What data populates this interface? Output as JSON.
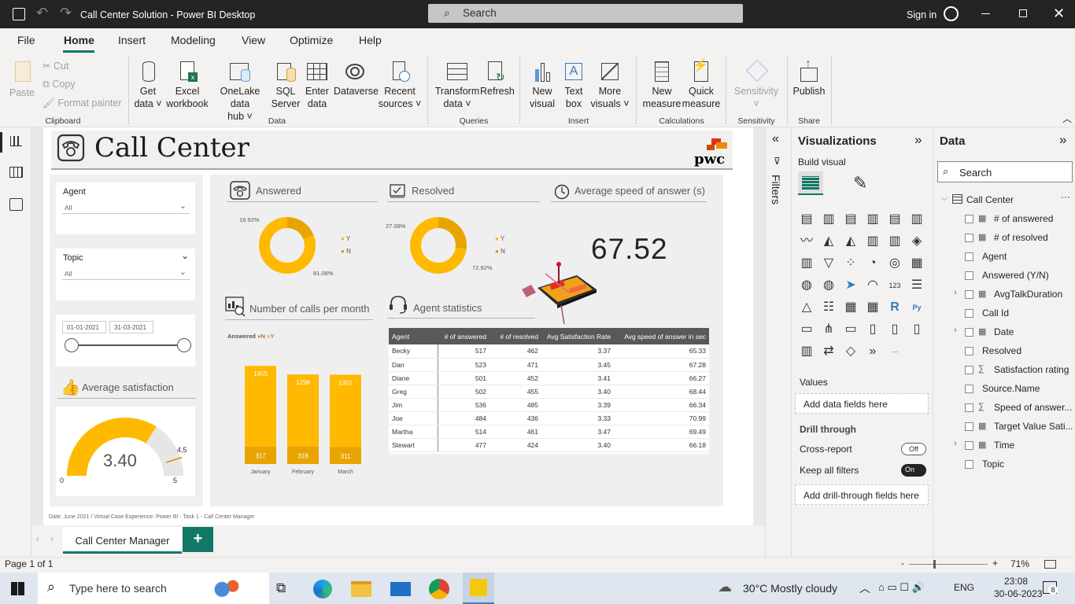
{
  "window": {
    "title": "Call Center Solution - Power BI Desktop",
    "search_placeholder": "Search",
    "sign_in": "Sign in"
  },
  "menu": [
    "File",
    "Home",
    "Insert",
    "Modeling",
    "View",
    "Optimize",
    "Help"
  ],
  "menu_active": "Home",
  "ribbon": {
    "clipboard": {
      "paste": "Paste",
      "cut": "Cut",
      "copy": "Copy",
      "format_painter": "Format painter",
      "group": "Clipboard"
    },
    "data": {
      "get_data_1": "Get",
      "get_data_2": "data",
      "excel_1": "Excel",
      "excel_2": "workbook",
      "onelake_1": "OneLake data",
      "onelake_2": "hub",
      "sql_1": "SQL",
      "sql_2": "Server",
      "enter_1": "Enter",
      "enter_2": "data",
      "dataverse": "Dataverse",
      "recent_1": "Recent",
      "recent_2": "sources",
      "group": "Data"
    },
    "queries": {
      "transform_1": "Transform",
      "transform_2": "data",
      "refresh": "Refresh",
      "group": "Queries"
    },
    "insert": {
      "new_visual_1": "New",
      "new_visual_2": "visual",
      "text_box_1": "Text",
      "text_box_2": "box",
      "more_1": "More",
      "more_2": "visuals",
      "group": "Insert"
    },
    "calculations": {
      "new_measure_1": "New",
      "new_measure_2": "measure",
      "quick_1": "Quick",
      "quick_2": "measure",
      "group": "Calculations"
    },
    "sensitivity": {
      "label": "Sensitivity",
      "group": "Sensitivity"
    },
    "share": {
      "publish": "Publish",
      "group": "Share"
    }
  },
  "report": {
    "title": "Call Center",
    "logo_text": "pwc",
    "slicers": {
      "agent_label": "Agent",
      "agent_value": "All",
      "topic_label": "Topic",
      "topic_value": "All",
      "date_from": "01-01-2021",
      "date_to": "31-03-2021"
    },
    "avg_satisfaction": {
      "title": "Average satisfaction",
      "value": "3.40",
      "min": "0",
      "max": "5",
      "target": "4,5"
    },
    "answered": {
      "title": "Answered",
      "pct_n": "18.92%",
      "pct_y": "81.08%",
      "legend_y": "Y",
      "legend_n": "N"
    },
    "resolved": {
      "title": "Resolved",
      "pct_n": "27.08%",
      "pct_y": "72.92%",
      "legend_y": "Y",
      "legend_n": "N"
    },
    "speed": {
      "title": "Average speed of answer (s)",
      "value": "67.52"
    },
    "calls_per_month": {
      "title": "Number of calls per month",
      "legend_title": "Answered",
      "legend_n": "N",
      "legend_y": "Y"
    },
    "agent_stats": {
      "title": "Agent statistics",
      "columns": [
        "Agent",
        "# of answered",
        "# of resolved",
        "Avg Satisfaction Rate",
        "Avg speed of answer in sec"
      ],
      "rows": [
        [
          "Becky",
          "517",
          "462",
          "3.37",
          "65.33"
        ],
        [
          "Dan",
          "523",
          "471",
          "3.45",
          "67.28"
        ],
        [
          "Diane",
          "501",
          "452",
          "3.41",
          "66.27"
        ],
        [
          "Greg",
          "502",
          "455",
          "3.40",
          "68.44"
        ],
        [
          "Jim",
          "536",
          "485",
          "3.39",
          "66.34"
        ],
        [
          "Joe",
          "484",
          "436",
          "3.33",
          "70.99"
        ],
        [
          "Martha",
          "514",
          "461",
          "3.47",
          "69.49"
        ],
        [
          "Stewart",
          "477",
          "424",
          "3.40",
          "66.18"
        ]
      ]
    },
    "footer": "Date: June 2021 / Virtual Case Experience: Power BI - Task 1 - Call Center Manager"
  },
  "chart_data": {
    "type": "bar",
    "categories": [
      "January",
      "February",
      "March"
    ],
    "series": [
      {
        "name": "N",
        "values": [
          317,
          318,
          311
        ]
      },
      {
        "name": "Y",
        "values": [
          1455,
          1298,
          1301
        ]
      }
    ],
    "stacked": true
  },
  "filters_label": "Filters",
  "viz_pane": {
    "title": "Visualizations",
    "build_visual": "Build visual",
    "values": "Values",
    "add_data_fields": "Add data fields here",
    "drill_through": "Drill through",
    "cross_report": "Cross-report",
    "cross_report_state": "Off",
    "keep_all_filters": "Keep all filters",
    "keep_all_state": "On",
    "add_drill": "Add drill-through fields here"
  },
  "data_pane": {
    "title": "Data",
    "search_placeholder": "Search",
    "table": "Call Center",
    "fields": [
      "# of answered",
      "# of resolved",
      "Agent",
      "Answered (Y/N)",
      "AvgTalkDuration",
      "Call Id",
      "Date",
      "Resolved",
      "Satisfaction rating",
      "Source.Name",
      "Speed of answer...",
      "Target Value Sati...",
      "Time",
      "Topic"
    ]
  },
  "page_tab": "Call Center Manager",
  "status": {
    "page": "Page 1 of 1",
    "zoom": "71%"
  },
  "taskbar": {
    "search": "Type here to search",
    "weather": "30°C  Mostly cloudy",
    "lang": "ENG",
    "time": "23:08",
    "date": "30-06-2023",
    "notif": "8"
  }
}
